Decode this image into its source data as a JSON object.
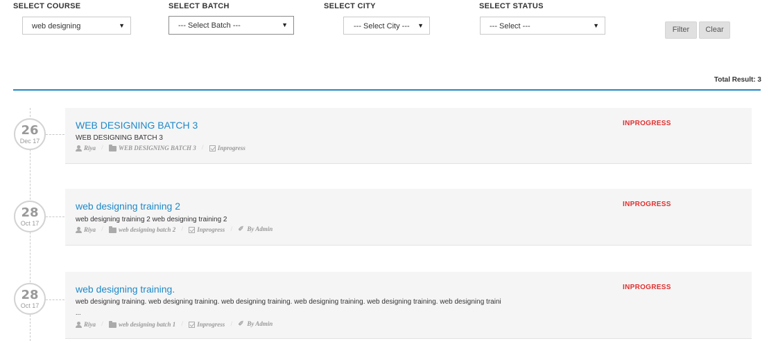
{
  "filters": {
    "course": {
      "label": "SELECT COURSE",
      "value": "web designing"
    },
    "batch": {
      "label": "SELECT BATCH",
      "value": "--- Select Batch ---"
    },
    "city": {
      "label": "SELECT CITY",
      "value": "--- Select City ---"
    },
    "status": {
      "label": "SELECT STATUS",
      "value": "--- Select ---"
    },
    "filter_button": "Filter",
    "clear_button": "Clear"
  },
  "results": {
    "total_label": "Total Result: 3",
    "accent_color": "#1e88c8",
    "status_color": "#e03030"
  },
  "entries": [
    {
      "day": "26",
      "month": "Dec 17",
      "title": "WEB DESIGNING BATCH 3",
      "description": "WEB DESIGNING BATCH 3",
      "author": "Riya",
      "batch": "WEB DESIGNING BATCH 3",
      "status_meta": "Inprogress",
      "status": "INPROGRESS"
    },
    {
      "day": "28",
      "month": "Oct 17",
      "title": "web designing training 2",
      "description": "web designing training 2 web designing training 2",
      "author": "Riya",
      "batch": "web designing batch 2",
      "status_meta": "Inprogress",
      "by": "By Admin",
      "status": "INPROGRESS"
    },
    {
      "day": "28",
      "month": "Oct 17",
      "title": "web designing training.",
      "description": "web designing training. web designing training. web designing training. web designing training. web designing training. web designing traini",
      "ellipsis": "...",
      "author": "Riya",
      "batch": "web designing batch 1",
      "status_meta": "Inprogress",
      "by": "By Admin",
      "status": "INPROGRESS"
    }
  ]
}
